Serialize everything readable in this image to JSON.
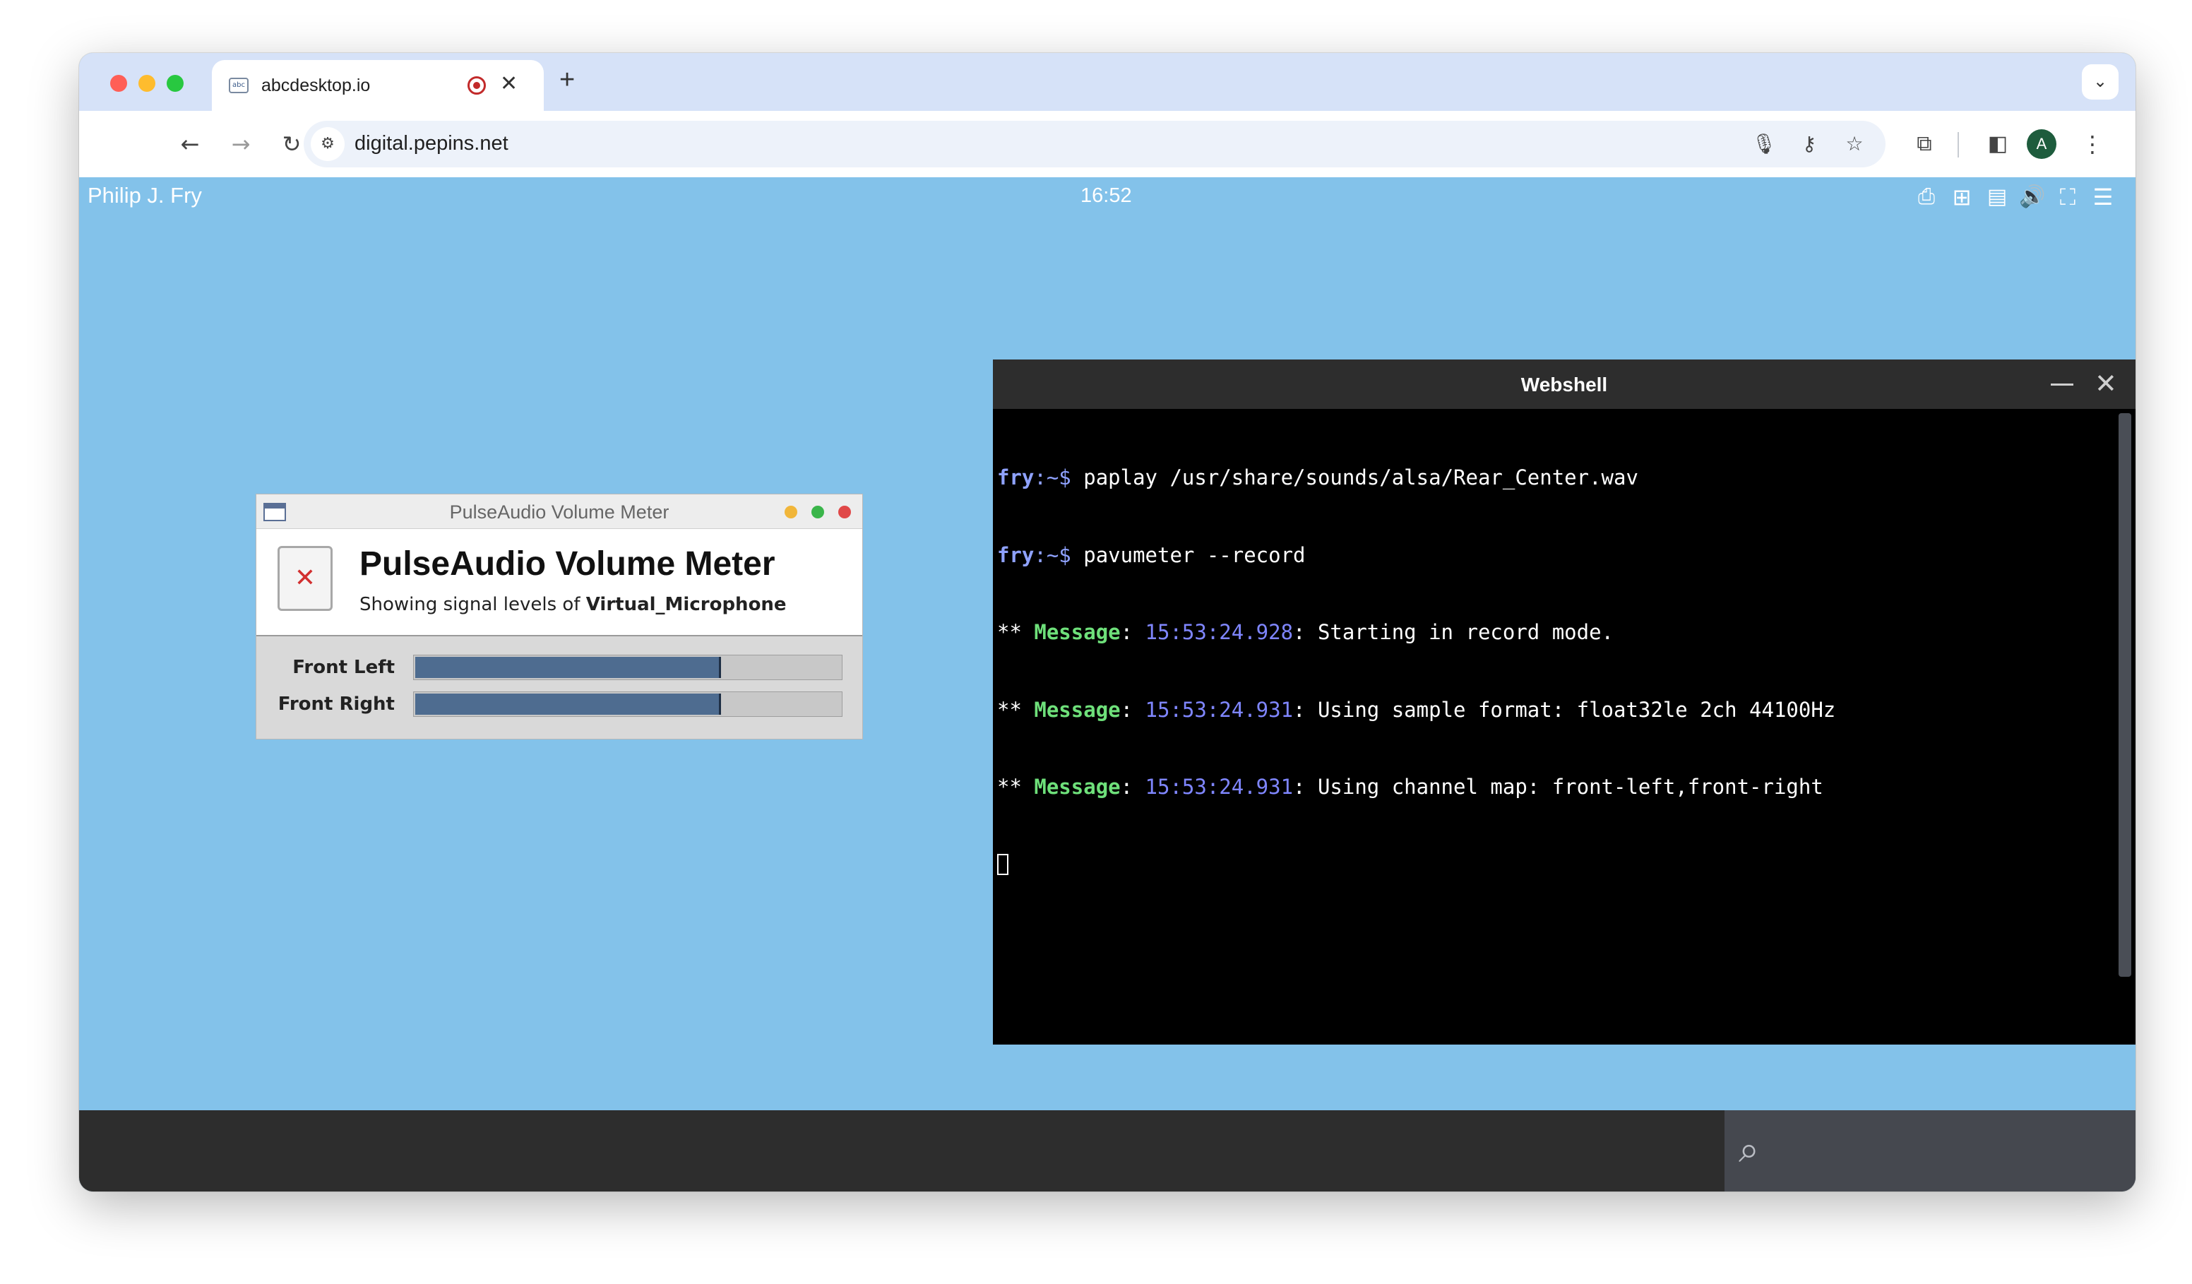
{
  "browser": {
    "tab": {
      "title": "abcdesktop.io",
      "favicon_text": "abc"
    },
    "address": {
      "url": "digital.pepins.net"
    },
    "avatar_letter": "A",
    "traffic_colors": {
      "close": "#ff5f57",
      "minimize": "#febc2e",
      "zoom": "#28c840"
    }
  },
  "desktop": {
    "user_name": "Philip J. Fry",
    "clock": "16:52",
    "tray_icons": [
      "printer-icon",
      "grid-icon",
      "clipboard-icon",
      "speaker-icon",
      "fullscreen-icon",
      "menu-icon"
    ]
  },
  "pulseaudio": {
    "window_title": "PulseAudio Volume Meter",
    "heading": "PulseAudio Volume Meter",
    "subtitle_prefix": "Showing signal levels of",
    "source_name": "Virtual_Microphone",
    "channels": [
      {
        "label": "Front Left",
        "level": 0.72
      },
      {
        "label": "Front Right",
        "level": 0.72
      }
    ]
  },
  "webshell": {
    "title": "Webshell",
    "lines": [
      {
        "user": "fry",
        "path": ":~$",
        "cmd": " paplay /usr/share/sounds/alsa/Rear_Center.wav"
      },
      {
        "user": "fry",
        "path": ":~$",
        "cmd": " pavumeter --record"
      },
      {
        "prefix": "** ",
        "tag": "Message",
        "sep": ": ",
        "time": "15:53:24.928",
        "text": ": Starting in record mode."
      },
      {
        "prefix": "** ",
        "tag": "Message",
        "sep": ": ",
        "time": "15:53:24.931",
        "text": ": Using sample format: float32le 2ch 44100Hz"
      },
      {
        "prefix": "** ",
        "tag": "Message",
        "sep": ": ",
        "time": "15:53:24.931",
        "text": ": Using channel map: front-left,front-right"
      }
    ]
  }
}
